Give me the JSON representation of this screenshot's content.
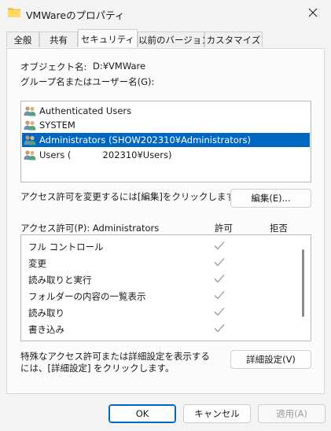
{
  "window": {
    "title": "VMWareのプロパティ",
    "folder_color": "#f5c04a"
  },
  "tabs": [
    {
      "label": "全般"
    },
    {
      "label": "共有"
    },
    {
      "label": "セキュリティ",
      "active": true
    },
    {
      "label": "以前のバージョン"
    },
    {
      "label": "カスタマイズ"
    }
  ],
  "security": {
    "object_name_label": "オブジェクト名:",
    "object_name_value": "D:¥VMWare",
    "groups_label": "グループ名またはユーザー名(G):",
    "users": [
      {
        "name": "Authenticated Users"
      },
      {
        "name": "SYSTEM"
      },
      {
        "name": "Administrators (SHOW202310¥Administrators)",
        "selected": true
      },
      {
        "name": "Users (           202310¥Users)"
      }
    ],
    "change_hint": "アクセス許可を変更するには[編集]をクリックします。",
    "edit_button": "編集(E)...",
    "perm_for_label": "アクセス許可(P): Administrators",
    "allow_header": "許可",
    "deny_header": "拒否",
    "permissions": [
      {
        "name": "フル コントロール",
        "allow": true,
        "deny": false
      },
      {
        "name": "変更",
        "allow": true,
        "deny": false
      },
      {
        "name": "読み取りと実行",
        "allow": true,
        "deny": false
      },
      {
        "name": "フォルダーの内容の一覧表示",
        "allow": true,
        "deny": false
      },
      {
        "name": "読み取り",
        "allow": true,
        "deny": false
      },
      {
        "name": "書き込み",
        "allow": true,
        "deny": false
      }
    ],
    "advanced_hint_line1": "特殊なアクセス許可または詳細設定を表示する",
    "advanced_hint_line2": "には、[詳細設定] をクリックします。",
    "advanced_button": "詳細設定(V)"
  },
  "footer": {
    "ok": "OK",
    "cancel": "キャンセル",
    "apply": "適用(A)"
  },
  "colors": {
    "selection": "#0067c0",
    "check": "#9a9a9a"
  }
}
